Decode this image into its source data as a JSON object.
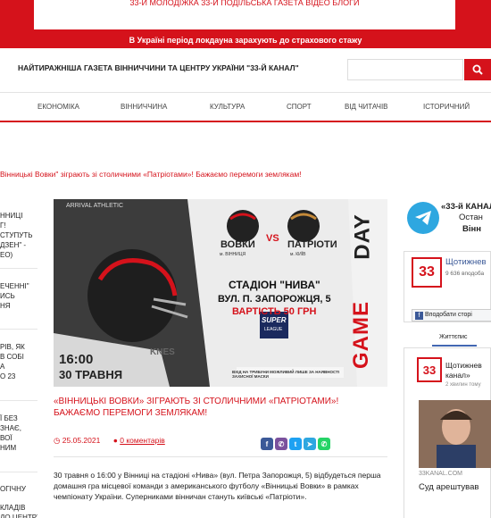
{
  "top_menu_text": "33-Й МОЛОДІЖКА   33-Й ПОДІЛЬСЬКА ГАЗЕТА   ВІДЕО   БЛОГИ",
  "alert_text": "В Україні період локдауна зарахують до страхового стажу",
  "header": {
    "tagline": "НАЙТИРАЖНІША ГАЗЕТА ВІННИЧЧИНИ ТА ЦЕНТРУ УКРАЇНИ \"33-Й КАНАЛ\"",
    "search_placeholder": ""
  },
  "nav": [
    {
      "label": "ЕКОНОМІКА"
    },
    {
      "label": "ВІННИЧЧИНА"
    },
    {
      "label": "КУЛЬТУРА"
    },
    {
      "label": "СПОРТ"
    },
    {
      "label": "ВІД ЧИТАЧІВ"
    },
    {
      "label": "ІСТОРИЧНИЙ"
    }
  ],
  "ticker": "Вінницькі Вовки\" зіграють зі столичними «Патріотами»! Бажаємо перемоги землякам!",
  "left_items": [
    "ННИЦІ\nГ!\nСТУПУТЬ\nДЗЕН\" -\nЕО)",
    "ЕЧЕННІ\"\nИСЬ\nНЯ",
    "РІВ, ЯК\nВ СОБІ\nА\nО 23",
    "Ї БЕЗ\nЗНАЄ,\nВОЇ\nНИМ",
    "ОГІЧНУ",
    "КЛАДІВ\nДО ЦЕНТРУ"
  ],
  "hero": {
    "brand": "ARRIVAL ATHLETIC",
    "team1": "ВОВКИ",
    "team1_city": "м. ВІННИЦЯ",
    "vs": "VS",
    "team2": "ПАТРІОТИ",
    "team2_city": "м. КИЇВ",
    "stadium": "СТАДІОН \"НИВА\"",
    "address": "ВУЛ. П. ЗАПОРОЖЦЯ, 5",
    "price": "ВАРТІСТЬ 50 ГРН",
    "league": "SUPER",
    "league_sub": "LEAGUE",
    "time": "16:00",
    "date": "30 ТРАВНЯ",
    "note": "ВХІД НА ТРИБУНИ МОЖЛИВИЙ ЛИШЕ ЗА НАЯВНОСТІ ЗАХИСНОЇ МАСКИ",
    "game": "GAME",
    "day": "DAY",
    "jersey": "KNES"
  },
  "article": {
    "headline": "«Вінницькі Вовки» зіграють зі столичними «Патріотами»! Бажаємо перемоги землякам!",
    "date": "25.05.2021",
    "comments": "0 коментарів",
    "body": "30 травня о 16:00 у Вінниці на стадіоні «Нива» (вул. Петра Запорожця, 5) відбудеться перша домашня гра місцевої команди з американського футболу «Вінницькі Вовки» в рамках чемпіонату України. Суперниками вінничан стануть київські «Патріоти»."
  },
  "share_buttons": [
    {
      "icon": "facebook-icon",
      "glyph": "f",
      "color": "#3b5998"
    },
    {
      "icon": "viber-icon",
      "glyph": "✆",
      "color": "#7b519d"
    },
    {
      "icon": "twitter-icon",
      "glyph": "t",
      "color": "#1da1f2"
    },
    {
      "icon": "telegram-icon",
      "glyph": "➤",
      "color": "#2ea7e0"
    },
    {
      "icon": "whatsapp-icon",
      "glyph": "✆",
      "color": "#25d366"
    }
  ],
  "telegram": {
    "title": "«33-й КАНАЛ»",
    "line2": "Остан",
    "line3": "Вінн"
  },
  "facebook": {
    "logo": "33",
    "page_name": "Щотижнев",
    "subscribers": "9 636 вподоба",
    "follow": "Вподобати сторі",
    "tab": "Життєпис",
    "post_name": "Щотижнев\nканал»",
    "post_time": "2 хвилин тому",
    "post_site": "33KANAL.COM",
    "post_title": "Суд арештував"
  },
  "colors": {
    "accent": "#d5121b",
    "telegram": "#2ea7e0",
    "facebook": "#3b5998"
  }
}
